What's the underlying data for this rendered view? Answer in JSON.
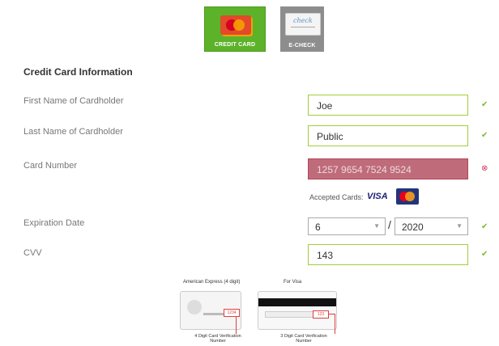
{
  "payment_tabs": {
    "credit_card": "CREDIT CARD",
    "echeck": "E-CHECK",
    "check_art_text": "check",
    "mastercard_art_text": "MasterCard"
  },
  "section_title": "Credit Card Information",
  "fields": {
    "first_name": {
      "label": "First Name of Cardholder",
      "value": "Joe",
      "status": "valid"
    },
    "last_name": {
      "label": "Last Name of Cardholder",
      "value": "Public",
      "status": "valid"
    },
    "card_number": {
      "label": "Card Number",
      "value": "1257 9654 7524 9524",
      "status": "invalid"
    },
    "expiration": {
      "label": "Expiration Date",
      "month": "6",
      "year": "2020",
      "separator": "/",
      "status": "valid"
    },
    "cvv": {
      "label": "CVV",
      "value": "143",
      "status": "valid"
    }
  },
  "accepted_cards": {
    "label": "Accepted Cards:",
    "visa": "VISA"
  },
  "status_glyphs": {
    "valid": "✔",
    "invalid": "⊗"
  },
  "colors": {
    "valid_border": "#9fcf3b",
    "error_bg": "#c06b7a",
    "active_tab": "#5cb229",
    "inactive_tab": "#8d8d8d"
  },
  "cvv_help": {
    "amex_title": "American Express (4 digit)",
    "visa_title": "For Visa",
    "amex_code": "1234",
    "visa_code": "123",
    "amex_caption": "4 Digit Card Verification Number",
    "visa_caption": "3 Digit Card Verification Number"
  }
}
